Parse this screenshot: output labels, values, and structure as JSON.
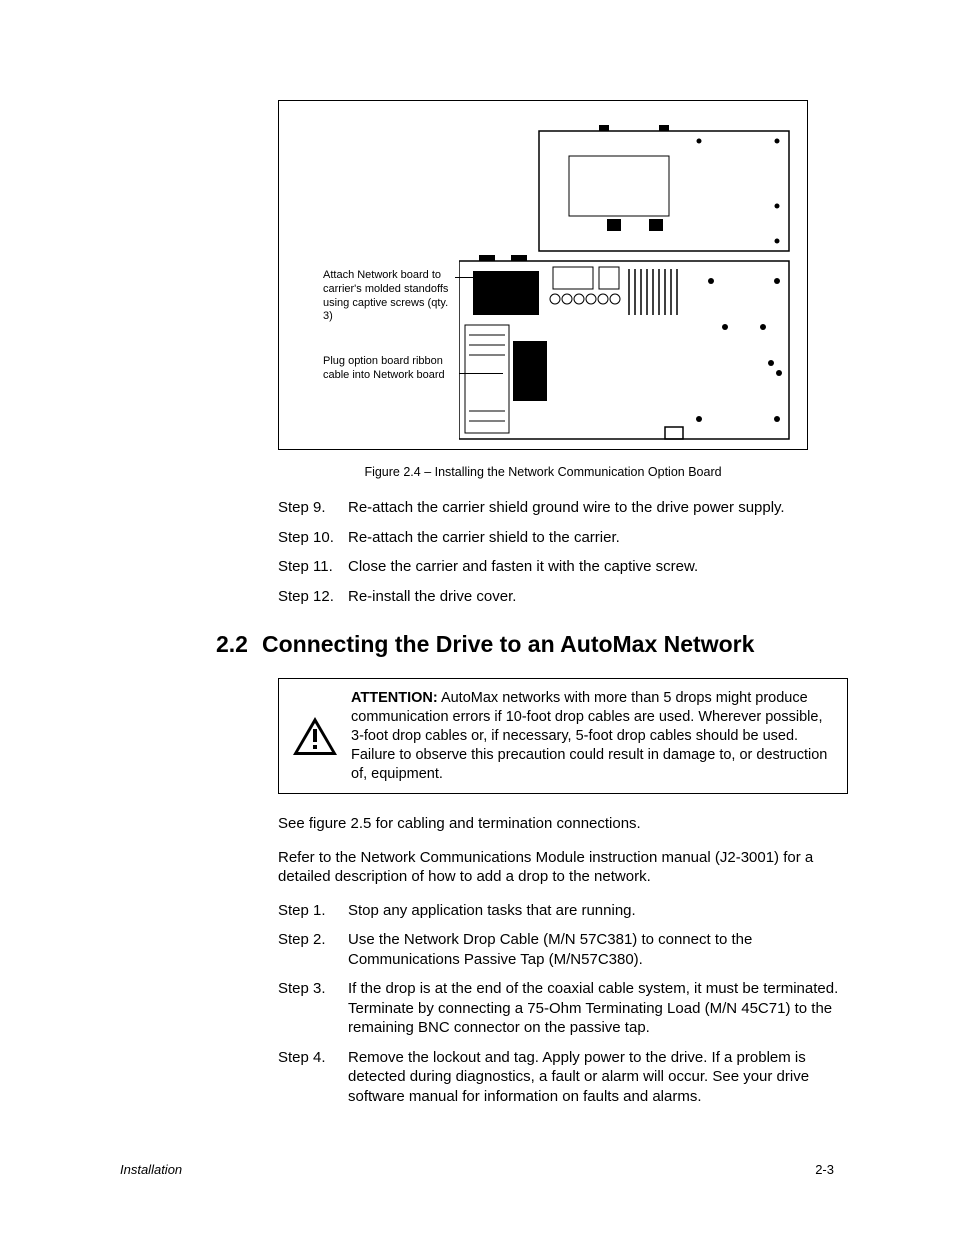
{
  "figure": {
    "callout1": "Attach Network board to carrier's molded standoffs using captive screws (qty. 3)",
    "callout2": "Plug option board ribbon cable into Network board",
    "caption": "Figure 2.4 – Installing the Network Communication Option Board"
  },
  "stepsTop": [
    {
      "label": "Step 9.",
      "text": "Re-attach the carrier shield ground wire to the drive power supply."
    },
    {
      "label": "Step 10.",
      "text": "Re-attach the carrier shield to the carrier."
    },
    {
      "label": "Step 11.",
      "text": "Close the carrier and fasten it with the captive screw."
    },
    {
      "label": "Step 12.",
      "text": "Re-install the drive cover."
    }
  ],
  "section": {
    "number": "2.2",
    "title": "Connecting the Drive to an AutoMax Network"
  },
  "attention": {
    "label": "ATTENTION:",
    "text": " AutoMax networks with more than 5 drops might produce communication errors if 10-foot drop cables are used. Wherever possible, 3-foot drop cables or, if necessary, 5-foot drop cables should be used. Failure to observe this precaution could result in damage to, or destruction of, equipment."
  },
  "para1": "See figure 2.5 for cabling and termination connections.",
  "para2": "Refer to the Network Communications Module instruction manual (J2-3001) for a detailed description of how to add a drop to the network.",
  "stepsBottom": [
    {
      "label": "Step 1.",
      "text": "Stop any application tasks that are running."
    },
    {
      "label": "Step 2.",
      "text": "Use the Network Drop Cable (M/N 57C381) to connect to the Communications Passive Tap (M/N57C380)."
    },
    {
      "label": "Step 3.",
      "text": "If the drop is at the end of the coaxial cable system, it must be terminated. Terminate by connecting a 75-Ohm Terminating Load (M/N 45C71) to the remaining BNC connector on the passive tap."
    },
    {
      "label": "Step 4.",
      "text": "Remove the lockout and tag. Apply power to the drive. If a problem is detected during diagnostics, a fault or alarm will occur. See your drive software manual for information on faults and alarms."
    }
  ],
  "footer": {
    "left": "Installation",
    "right": "2-3"
  }
}
